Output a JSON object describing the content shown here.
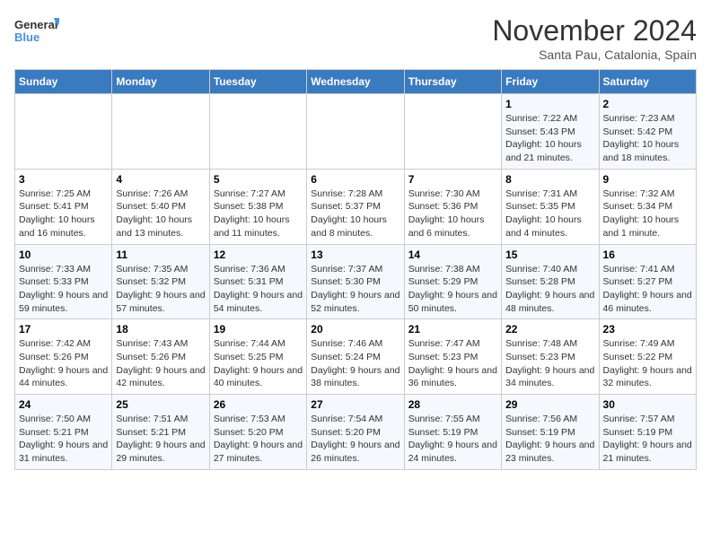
{
  "logo": {
    "line1": "General",
    "line2": "Blue"
  },
  "title": "November 2024",
  "location": "Santa Pau, Catalonia, Spain",
  "weekdays": [
    "Sunday",
    "Monday",
    "Tuesday",
    "Wednesday",
    "Thursday",
    "Friday",
    "Saturday"
  ],
  "weeks": [
    [
      {
        "day": "",
        "detail": ""
      },
      {
        "day": "",
        "detail": ""
      },
      {
        "day": "",
        "detail": ""
      },
      {
        "day": "",
        "detail": ""
      },
      {
        "day": "",
        "detail": ""
      },
      {
        "day": "1",
        "detail": "Sunrise: 7:22 AM\nSunset: 5:43 PM\nDaylight: 10 hours and 21 minutes."
      },
      {
        "day": "2",
        "detail": "Sunrise: 7:23 AM\nSunset: 5:42 PM\nDaylight: 10 hours and 18 minutes."
      }
    ],
    [
      {
        "day": "3",
        "detail": "Sunrise: 7:25 AM\nSunset: 5:41 PM\nDaylight: 10 hours and 16 minutes."
      },
      {
        "day": "4",
        "detail": "Sunrise: 7:26 AM\nSunset: 5:40 PM\nDaylight: 10 hours and 13 minutes."
      },
      {
        "day": "5",
        "detail": "Sunrise: 7:27 AM\nSunset: 5:38 PM\nDaylight: 10 hours and 11 minutes."
      },
      {
        "day": "6",
        "detail": "Sunrise: 7:28 AM\nSunset: 5:37 PM\nDaylight: 10 hours and 8 minutes."
      },
      {
        "day": "7",
        "detail": "Sunrise: 7:30 AM\nSunset: 5:36 PM\nDaylight: 10 hours and 6 minutes."
      },
      {
        "day": "8",
        "detail": "Sunrise: 7:31 AM\nSunset: 5:35 PM\nDaylight: 10 hours and 4 minutes."
      },
      {
        "day": "9",
        "detail": "Sunrise: 7:32 AM\nSunset: 5:34 PM\nDaylight: 10 hours and 1 minute."
      }
    ],
    [
      {
        "day": "10",
        "detail": "Sunrise: 7:33 AM\nSunset: 5:33 PM\nDaylight: 9 hours and 59 minutes."
      },
      {
        "day": "11",
        "detail": "Sunrise: 7:35 AM\nSunset: 5:32 PM\nDaylight: 9 hours and 57 minutes."
      },
      {
        "day": "12",
        "detail": "Sunrise: 7:36 AM\nSunset: 5:31 PM\nDaylight: 9 hours and 54 minutes."
      },
      {
        "day": "13",
        "detail": "Sunrise: 7:37 AM\nSunset: 5:30 PM\nDaylight: 9 hours and 52 minutes."
      },
      {
        "day": "14",
        "detail": "Sunrise: 7:38 AM\nSunset: 5:29 PM\nDaylight: 9 hours and 50 minutes."
      },
      {
        "day": "15",
        "detail": "Sunrise: 7:40 AM\nSunset: 5:28 PM\nDaylight: 9 hours and 48 minutes."
      },
      {
        "day": "16",
        "detail": "Sunrise: 7:41 AM\nSunset: 5:27 PM\nDaylight: 9 hours and 46 minutes."
      }
    ],
    [
      {
        "day": "17",
        "detail": "Sunrise: 7:42 AM\nSunset: 5:26 PM\nDaylight: 9 hours and 44 minutes."
      },
      {
        "day": "18",
        "detail": "Sunrise: 7:43 AM\nSunset: 5:26 PM\nDaylight: 9 hours and 42 minutes."
      },
      {
        "day": "19",
        "detail": "Sunrise: 7:44 AM\nSunset: 5:25 PM\nDaylight: 9 hours and 40 minutes."
      },
      {
        "day": "20",
        "detail": "Sunrise: 7:46 AM\nSunset: 5:24 PM\nDaylight: 9 hours and 38 minutes."
      },
      {
        "day": "21",
        "detail": "Sunrise: 7:47 AM\nSunset: 5:23 PM\nDaylight: 9 hours and 36 minutes."
      },
      {
        "day": "22",
        "detail": "Sunrise: 7:48 AM\nSunset: 5:23 PM\nDaylight: 9 hours and 34 minutes."
      },
      {
        "day": "23",
        "detail": "Sunrise: 7:49 AM\nSunset: 5:22 PM\nDaylight: 9 hours and 32 minutes."
      }
    ],
    [
      {
        "day": "24",
        "detail": "Sunrise: 7:50 AM\nSunset: 5:21 PM\nDaylight: 9 hours and 31 minutes."
      },
      {
        "day": "25",
        "detail": "Sunrise: 7:51 AM\nSunset: 5:21 PM\nDaylight: 9 hours and 29 minutes."
      },
      {
        "day": "26",
        "detail": "Sunrise: 7:53 AM\nSunset: 5:20 PM\nDaylight: 9 hours and 27 minutes."
      },
      {
        "day": "27",
        "detail": "Sunrise: 7:54 AM\nSunset: 5:20 PM\nDaylight: 9 hours and 26 minutes."
      },
      {
        "day": "28",
        "detail": "Sunrise: 7:55 AM\nSunset: 5:19 PM\nDaylight: 9 hours and 24 minutes."
      },
      {
        "day": "29",
        "detail": "Sunrise: 7:56 AM\nSunset: 5:19 PM\nDaylight: 9 hours and 23 minutes."
      },
      {
        "day": "30",
        "detail": "Sunrise: 7:57 AM\nSunset: 5:19 PM\nDaylight: 9 hours and 21 minutes."
      }
    ]
  ]
}
